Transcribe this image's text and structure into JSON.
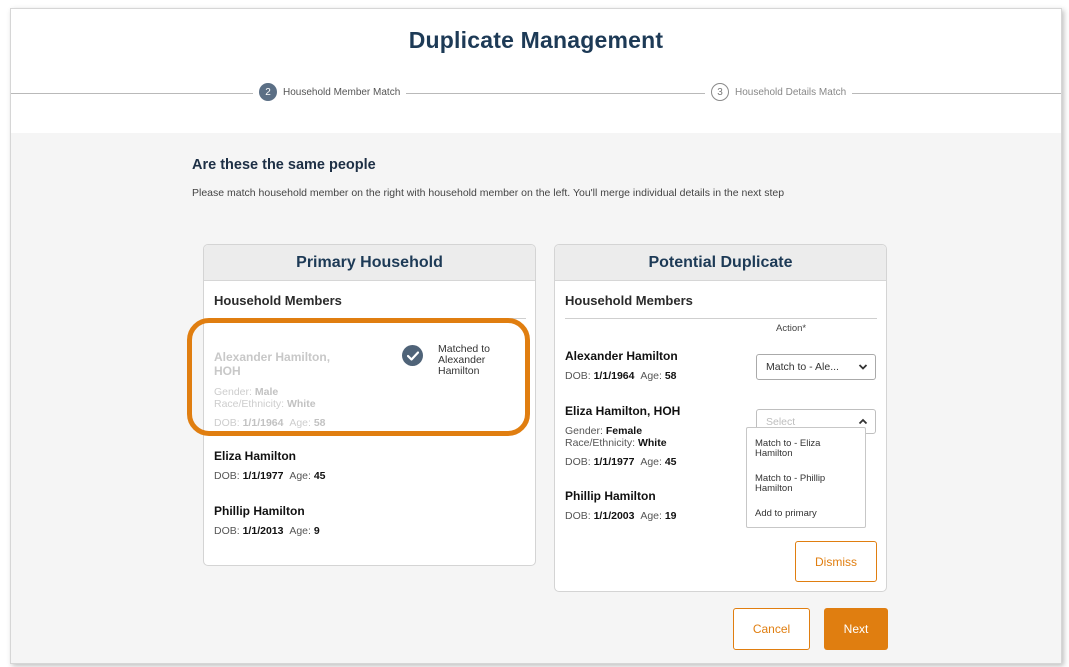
{
  "page": {
    "title": "Duplicate Management"
  },
  "stepper": {
    "steps": [
      {
        "number": "2",
        "label": "Household Member Match",
        "active": true
      },
      {
        "number": "3",
        "label": "Household Details Match",
        "active": false
      }
    ]
  },
  "section": {
    "title": "Are these the same people",
    "description": "Please match household member on the right with household member on the left. You'll merge individual details in the next step"
  },
  "primary": {
    "heading": "Primary Household",
    "subheading": "Household Members",
    "members": [
      {
        "name_line1": "Alexander Hamilton,",
        "name_line2": "HOH",
        "gender_label": "Gender:",
        "gender": "Male",
        "race_label": "Race/Ethnicity:",
        "race": "White",
        "dob_label": "DOB:",
        "dob": "1/1/1964",
        "age_label": "Age:",
        "age": "58",
        "status": "matched",
        "matched_text": "Matched to Alexander Hamilton"
      },
      {
        "name": "Eliza Hamilton",
        "dob_label": "DOB:",
        "dob": "1/1/1977",
        "age_label": "Age:",
        "age": "45"
      },
      {
        "name": "Phillip Hamilton",
        "dob_label": "DOB:",
        "dob": "1/1/2013",
        "age_label": "Age:",
        "age": "9"
      }
    ]
  },
  "duplicate": {
    "heading": "Potential Duplicate",
    "subheading": "Household Members",
    "action_label": "Action*",
    "members": [
      {
        "name": "Alexander Hamilton",
        "dob_label": "DOB:",
        "dob": "1/1/1964",
        "age_label": "Age:",
        "age": "58",
        "action_value": "Match to - Ale..."
      },
      {
        "name": "Eliza Hamilton, HOH",
        "gender_label": "Gender:",
        "gender": "Female",
        "race_label": "Race/Ethnicity:",
        "race": "White",
        "dob_label": "DOB:",
        "dob": "1/1/1977",
        "age_label": "Age:",
        "age": "45",
        "action_placeholder": "Select",
        "dropdown_open": true
      },
      {
        "name": "Phillip Hamilton",
        "dob_label": "DOB:",
        "dob": "1/1/2003",
        "age_label": "Age:",
        "age": "19"
      }
    ],
    "dropdown_options": [
      "Match to - Eliza Hamilton",
      "Match to - Phillip Hamilton",
      "Add to primary"
    ],
    "dismiss_label": "Dismiss"
  },
  "footer": {
    "cancel_label": "Cancel",
    "next_label": "Next"
  },
  "colors": {
    "accent": "#e07e10",
    "navy": "#1d3a56",
    "check": "#4f6378"
  },
  "icons": [
    "check-circle-icon",
    "chevron-down-icon",
    "chevron-up-icon"
  ]
}
